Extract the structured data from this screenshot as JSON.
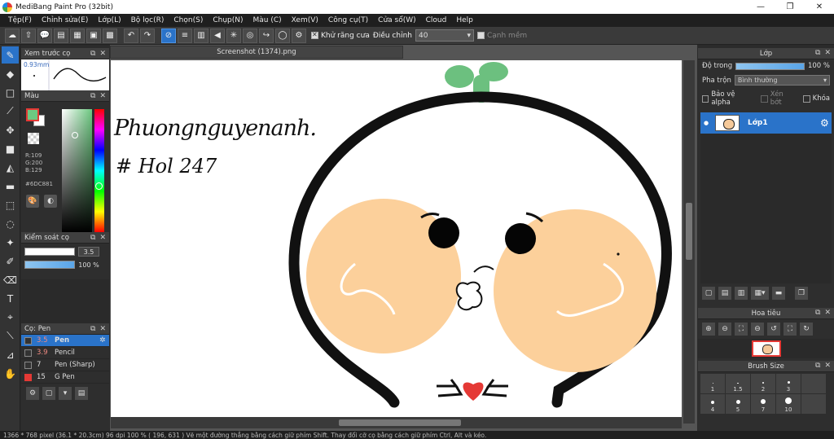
{
  "window": {
    "title": "MediBang Paint Pro (32bit)",
    "controls": [
      "—",
      "❐",
      "✕"
    ]
  },
  "menu": [
    "Tệp(F)",
    "Chỉnh sửa(E)",
    "Lớp(L)",
    "Bộ lọc(R)",
    "Chọn(S)",
    "Chụp(N)",
    "Màu (C)",
    "Xem(V)",
    "Công cụ(T)",
    "Cửa sổ(W)",
    "Cloud",
    "Help"
  ],
  "toolbar": {
    "antialias_label": "Khử răng cưa",
    "adjust_label": "Điều chỉnh",
    "adjust_value": "40",
    "snap_label": "Cạnh mềm"
  },
  "brush_preview": {
    "title": "Xem trước cọ",
    "size": "0.93mm"
  },
  "color_panel": {
    "title": "Màu",
    "r": "R:109",
    "g": "G:200",
    "b": "B:129",
    "hex": "#6DC881",
    "fg_color": "#6DC881"
  },
  "brush_control": {
    "title": "Kiểm soát cọ",
    "size": "3.5",
    "opacity": "100 %"
  },
  "brush_list": {
    "title": "Cọ: Pen",
    "items": [
      {
        "size": "3.5",
        "name": "Pen",
        "selected": true
      },
      {
        "size": "3.9",
        "name": "Pencil"
      },
      {
        "size": "7",
        "name": "Pen (Sharp)"
      },
      {
        "size": "15",
        "name": "G Pen"
      }
    ]
  },
  "document": {
    "tab": "Screenshot (1374).png",
    "text_line1": "Phuongnguyenanh.",
    "text_line2": "# Hol 247"
  },
  "layer_panel": {
    "title": "Lớp",
    "opacity_label": "Độ trong",
    "opacity_value": "100 %",
    "blend_label": "Pha trộn",
    "blend_value": "Bình thường",
    "protect_alpha": "Bảo vệ alpha",
    "clipping": "Xén bớt",
    "lock": "Khóa",
    "layer_name": "Lớp1"
  },
  "navigator": {
    "title": "Hoa tiêu"
  },
  "brush_size": {
    "title": "Brush Size",
    "labels": [
      "1",
      "1.5",
      "2",
      "3",
      "4",
      "5",
      "7",
      "10"
    ]
  },
  "status": "1366 * 768 pixel   (36.1 * 20.3cm)   96 dpi   100 %   ( 196, 631 )   Vẽ một đường thẳng bằng cách giữ phím Shift. Thay đổi cỡ cọ bằng cách giữ phím Ctrl, Alt và kéo."
}
